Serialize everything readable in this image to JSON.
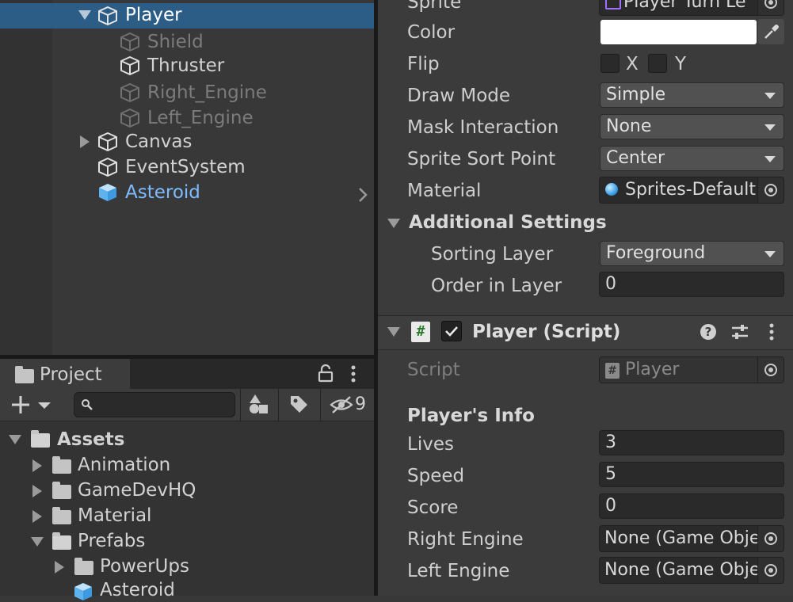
{
  "hierarchy": {
    "items": [
      {
        "label": "Player"
      },
      {
        "label": "Shield"
      },
      {
        "label": "Thruster"
      },
      {
        "label": "Right_Engine"
      },
      {
        "label": "Left_Engine"
      },
      {
        "label": "Canvas"
      },
      {
        "label": "EventSystem"
      },
      {
        "label": "Asteroid"
      }
    ]
  },
  "project": {
    "tab_label": "Project",
    "hidden_count": "9",
    "tree": [
      {
        "label": "Assets"
      },
      {
        "label": "Animation"
      },
      {
        "label": "GameDevHQ"
      },
      {
        "label": "Material"
      },
      {
        "label": "Prefabs"
      },
      {
        "label": "PowerUps"
      },
      {
        "label": "Asteroid"
      }
    ]
  },
  "inspector": {
    "sprite_renderer": {
      "sprite_label": "Sprite",
      "sprite_value": "Player Turn Le",
      "color_label": "Color",
      "color_value": "#ffffff",
      "flip_label": "Flip",
      "flip_x": "X",
      "flip_y": "Y",
      "draw_mode_label": "Draw Mode",
      "draw_mode_value": "Simple",
      "mask_label": "Mask Interaction",
      "mask_value": "None",
      "sort_point_label": "Sprite Sort Point",
      "sort_point_value": "Center",
      "material_label": "Material",
      "material_value": "Sprites-Default",
      "additional_label": "Additional Settings",
      "sorting_layer_label": "Sorting Layer",
      "sorting_layer_value": "Foreground",
      "order_label": "Order in Layer",
      "order_value": "0"
    },
    "script_component": {
      "title": "Player (Script)",
      "script_label": "Script",
      "script_value": "Player",
      "section_header": "Player's Info",
      "lives_label": "Lives",
      "lives_value": "3",
      "speed_label": "Speed",
      "speed_value": "5",
      "score_label": "Score",
      "score_value": "0",
      "right_engine_label": "Right Engine",
      "right_engine_value": "None (Game Obje",
      "left_engine_label": "Left Engine",
      "left_engine_value": "None (Game Obje"
    }
  },
  "colors": {
    "selection": "#2c5d87",
    "prefab_blue": "#7cbcff",
    "panel_bg": "#383838"
  }
}
